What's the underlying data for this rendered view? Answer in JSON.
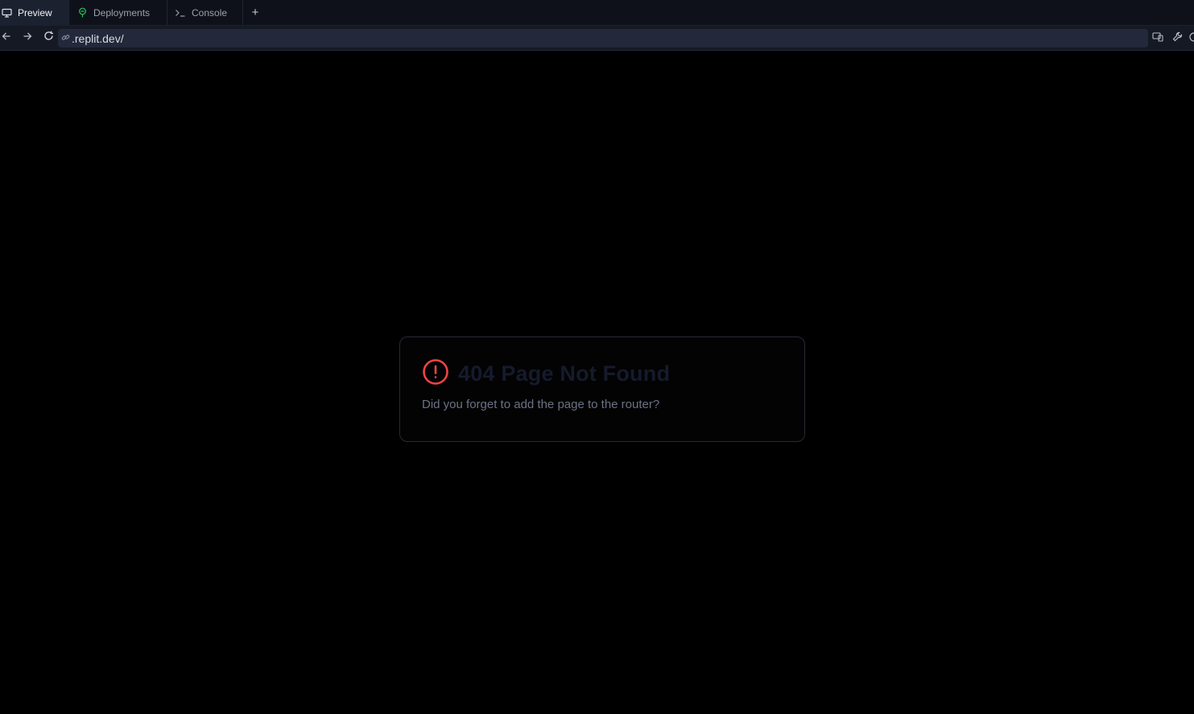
{
  "tabs": [
    {
      "label": "Preview",
      "icon": "monitor-icon",
      "active": true
    },
    {
      "label": "Deployments",
      "icon": "deployments-icon",
      "active": false
    },
    {
      "label": "Console",
      "icon": "terminal-icon",
      "active": false
    }
  ],
  "add_tab": "+",
  "address": {
    "url": ".replit.dev/"
  },
  "error": {
    "title": "404 Page Not Found",
    "message": "Did you forget to add the page to the router?",
    "icon": "alert-circle-icon",
    "icon_color": "#ef4444"
  },
  "colors": {
    "background": "#000000",
    "tabbar": "#0e1119",
    "accent_green": "#22c55e"
  }
}
